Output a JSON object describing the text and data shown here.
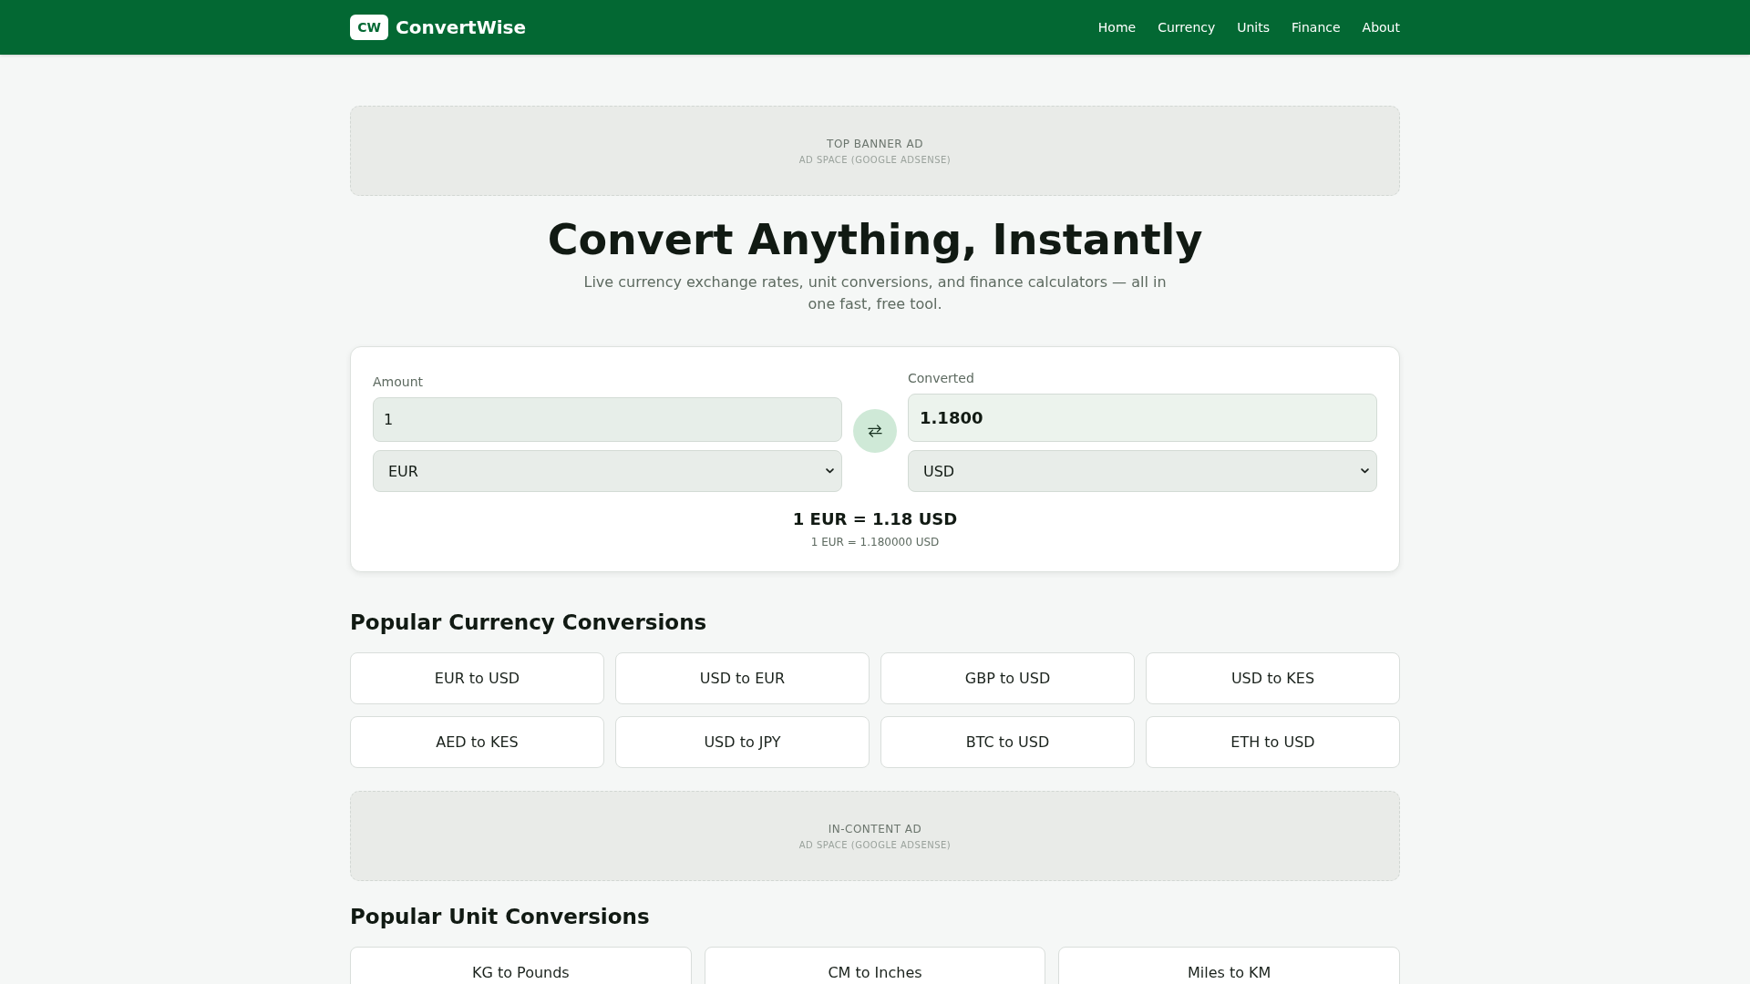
{
  "header": {
    "logo_badge": "CW",
    "brand": "ConvertWise",
    "nav_links": [
      "Home",
      "Currency",
      "Units",
      "Finance",
      "About"
    ]
  },
  "top_ad": {
    "label": "TOP BANNER AD",
    "note": "AD SPACE (GOOGLE ADSENSE)"
  },
  "hero": {
    "title": "Convert Anything, Instantly",
    "subtitle": "Live currency exchange rates, unit conversions, and finance calculators — all in one fast, free tool."
  },
  "converter": {
    "amount": {
      "label": "Amount",
      "value": "1",
      "currency": "EUR"
    },
    "converted": {
      "label": "Converted",
      "value": "1.1800",
      "currency": "USD"
    },
    "rate": "1 EUR = 1.18 USD",
    "rate_detail": "1 EUR = 1.180000 USD"
  },
  "currency_section": {
    "title": "Popular Currency Conversions",
    "links": [
      "EUR to USD",
      "USD to EUR",
      "GBP to USD",
      "USD to KES",
      "AED to KES",
      "USD to JPY",
      "BTC to USD",
      "ETH to USD"
    ]
  },
  "in_content_ad": {
    "label": "IN-CONTENT AD",
    "note": "AD SPACE (GOOGLE ADSENSE)"
  },
  "unit_section": {
    "title": "Popular Unit Conversions",
    "links": [
      "KG to Pounds",
      "CM to Inches",
      "Miles to KM"
    ]
  }
}
